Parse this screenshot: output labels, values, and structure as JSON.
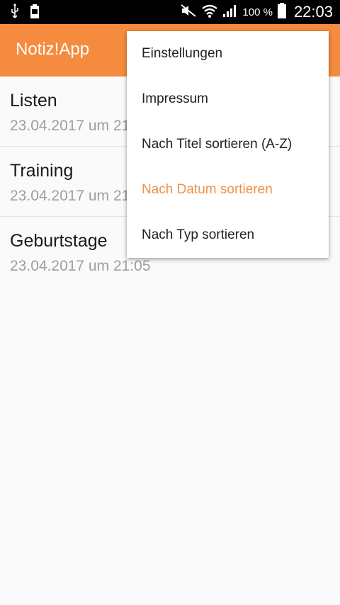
{
  "status_bar": {
    "battery_percent": "100 %",
    "clock": "22:03",
    "left_icons": [
      "usb-icon",
      "battery-full-small-icon"
    ],
    "right_icons": [
      "mute-icon",
      "wifi-icon",
      "signal-icon",
      "battery-icon"
    ]
  },
  "app_bar": {
    "title": "Notiz!App",
    "color": "#f58b3f"
  },
  "notes": [
    {
      "title": "Listen",
      "date": "23.04.2017 um 21:05"
    },
    {
      "title": "Training",
      "date": "23.04.2017 um 21:05"
    },
    {
      "title": "Geburtstage",
      "date": "23.04.2017 um 21:05"
    }
  ],
  "menu": {
    "items": [
      {
        "label": "Einstellungen"
      },
      {
        "label": "Impressum"
      },
      {
        "label": "Nach Titel sortieren (A-Z)"
      },
      {
        "label": "Nach Datum sortieren",
        "selected": true
      },
      {
        "label": "Nach Typ sortieren"
      }
    ],
    "accent_color": "#f0914a"
  }
}
